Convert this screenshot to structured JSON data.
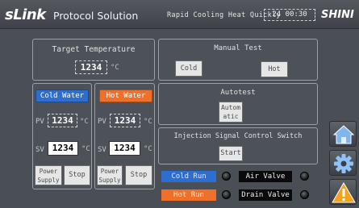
{
  "header": {
    "brand": "sLink",
    "brand_sub": "Protocol Solution",
    "slogan": "Rapid Cooling Heat Quickly",
    "clock": "24 00:30",
    "logo": "SHINI"
  },
  "target": {
    "title": "Target Temperature",
    "value": "1234",
    "unit": "°C"
  },
  "cold_water": {
    "tab_label": "Cold Water",
    "pv_prefix": "PV",
    "pv_value": "1234",
    "pv_unit": "°C",
    "sv_prefix": "SV",
    "sv_value": "1234",
    "sv_unit": "°C",
    "power_label": "Power Supply",
    "stop_label": "Stop"
  },
  "hot_water": {
    "tab_label": "Hot Water",
    "pv_prefix": "PV",
    "pv_value": "1234",
    "pv_unit": "°C",
    "sv_prefix": "SV",
    "sv_value": "1234",
    "sv_unit": "°C",
    "power_label": "Power Supply",
    "stop_label": "Stop"
  },
  "manual_test": {
    "title": "Manual Test",
    "cold_label": "Cold",
    "hot_label": "Hot"
  },
  "autotest": {
    "title": "Autotest",
    "button_label": "Automatic"
  },
  "injection": {
    "title": "Injection Signal Control Switch",
    "start_label": "Start"
  },
  "indicators": {
    "cold_run": "Cold Run",
    "hot_run": "Hot Run",
    "air_valve": "Air Valve",
    "drain_valve": "Drain Valve"
  },
  "side": {
    "home_icon": "home-icon",
    "settings_icon": "gear-icon",
    "alarm_icon": "warning-icon"
  },
  "colors": {
    "blue": "#2d6fd0",
    "orange": "#f0702a",
    "background": "#4a4f56"
  }
}
